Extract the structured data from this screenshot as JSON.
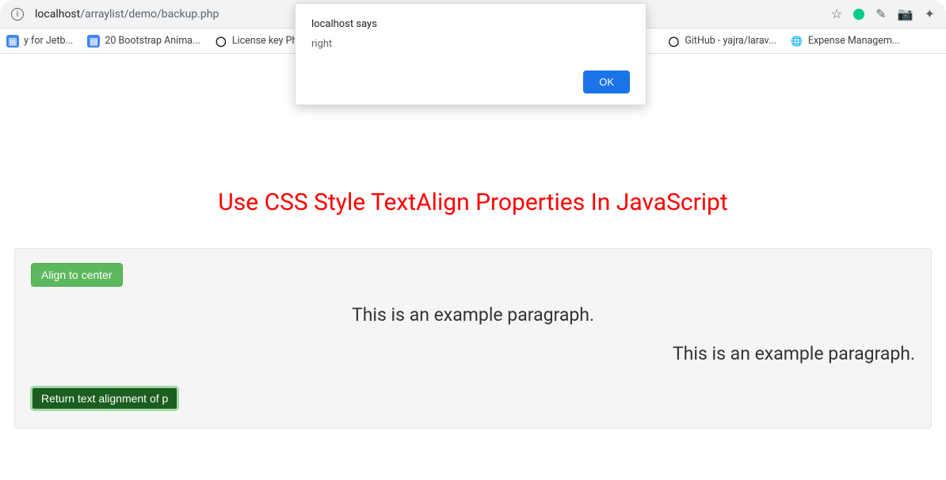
{
  "address_bar": {
    "host": "localhost",
    "path": "/arraylist/demo/backup.php"
  },
  "bookmarks": [
    {
      "label": "y for Jetb...",
      "favicon": "doc"
    },
    {
      "label": "20 Bootstrap Anima...",
      "favicon": "doc"
    },
    {
      "label": "License key PhpStor...",
      "favicon": "gh"
    },
    {
      "label": "GitHub - yajra/larav...",
      "favicon": "gh"
    },
    {
      "label": "Expense Managem...",
      "favicon": "globe"
    }
  ],
  "alert": {
    "title": "localhost says",
    "message": "right",
    "ok_label": "OK"
  },
  "page": {
    "heading": "Use CSS Style TextAlign Properties In JavaScript",
    "align_button": "Align to center",
    "paragraph1": "This is an example paragraph.",
    "paragraph2": "This is an example paragraph.",
    "return_button": "Return text alignment of p"
  }
}
